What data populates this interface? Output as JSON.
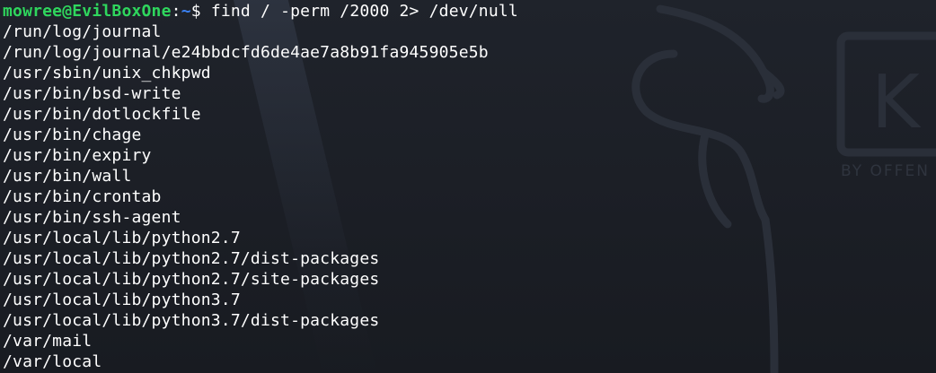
{
  "prompt": {
    "user_host": "mowree@EvilBoxOne",
    "colon": ":",
    "path": "~",
    "dollar": "$ ",
    "command": "find / -perm /2000 2> /dev/null"
  },
  "output": [
    "/run/log/journal",
    "/run/log/journal/e24bbdcfd6de4ae7a8b91fa945905e5b",
    "/usr/sbin/unix_chkpwd",
    "/usr/bin/bsd-write",
    "/usr/bin/dotlockfile",
    "/usr/bin/chage",
    "/usr/bin/expiry",
    "/usr/bin/wall",
    "/usr/bin/crontab",
    "/usr/bin/ssh-agent",
    "/usr/local/lib/python2.7",
    "/usr/local/lib/python2.7/dist-packages",
    "/usr/local/lib/python2.7/site-packages",
    "/usr/local/lib/python3.7",
    "/usr/local/lib/python3.7/dist-packages",
    "/var/mail",
    "/var/local"
  ],
  "wallpaper": {
    "logo_letter": "K",
    "logo_subtitle": "BY OFFEN"
  },
  "colors": {
    "background": "#1f232b",
    "text": "#ffffff",
    "prompt_user": "#2fd65d",
    "prompt_path": "#3b82f6"
  }
}
